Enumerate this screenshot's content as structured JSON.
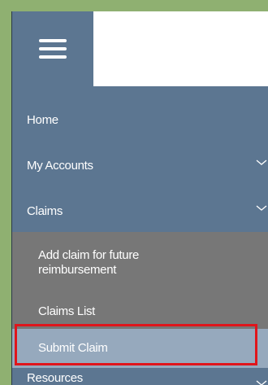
{
  "header": {
    "menu_icon": "hamburger-icon"
  },
  "nav": {
    "items": [
      {
        "label": "Home"
      },
      {
        "label": "My Accounts",
        "icon": "chevron-down-icon"
      },
      {
        "label": "Claims",
        "icon": "chevron-down-icon"
      }
    ],
    "claims_submenu": [
      {
        "label": "Add claim for future reimbursement"
      },
      {
        "label": "Claims List"
      },
      {
        "label": "Submit Claim"
      }
    ],
    "resources": {
      "label": "Resources",
      "icon": "chevron-down-icon"
    }
  },
  "colors": {
    "nav_bg": "#5c7691",
    "submenu_bg": "#777777",
    "selected_bg": "#96a9bd",
    "highlight_border": "#e0151b",
    "outer_border": "#8fb071"
  }
}
